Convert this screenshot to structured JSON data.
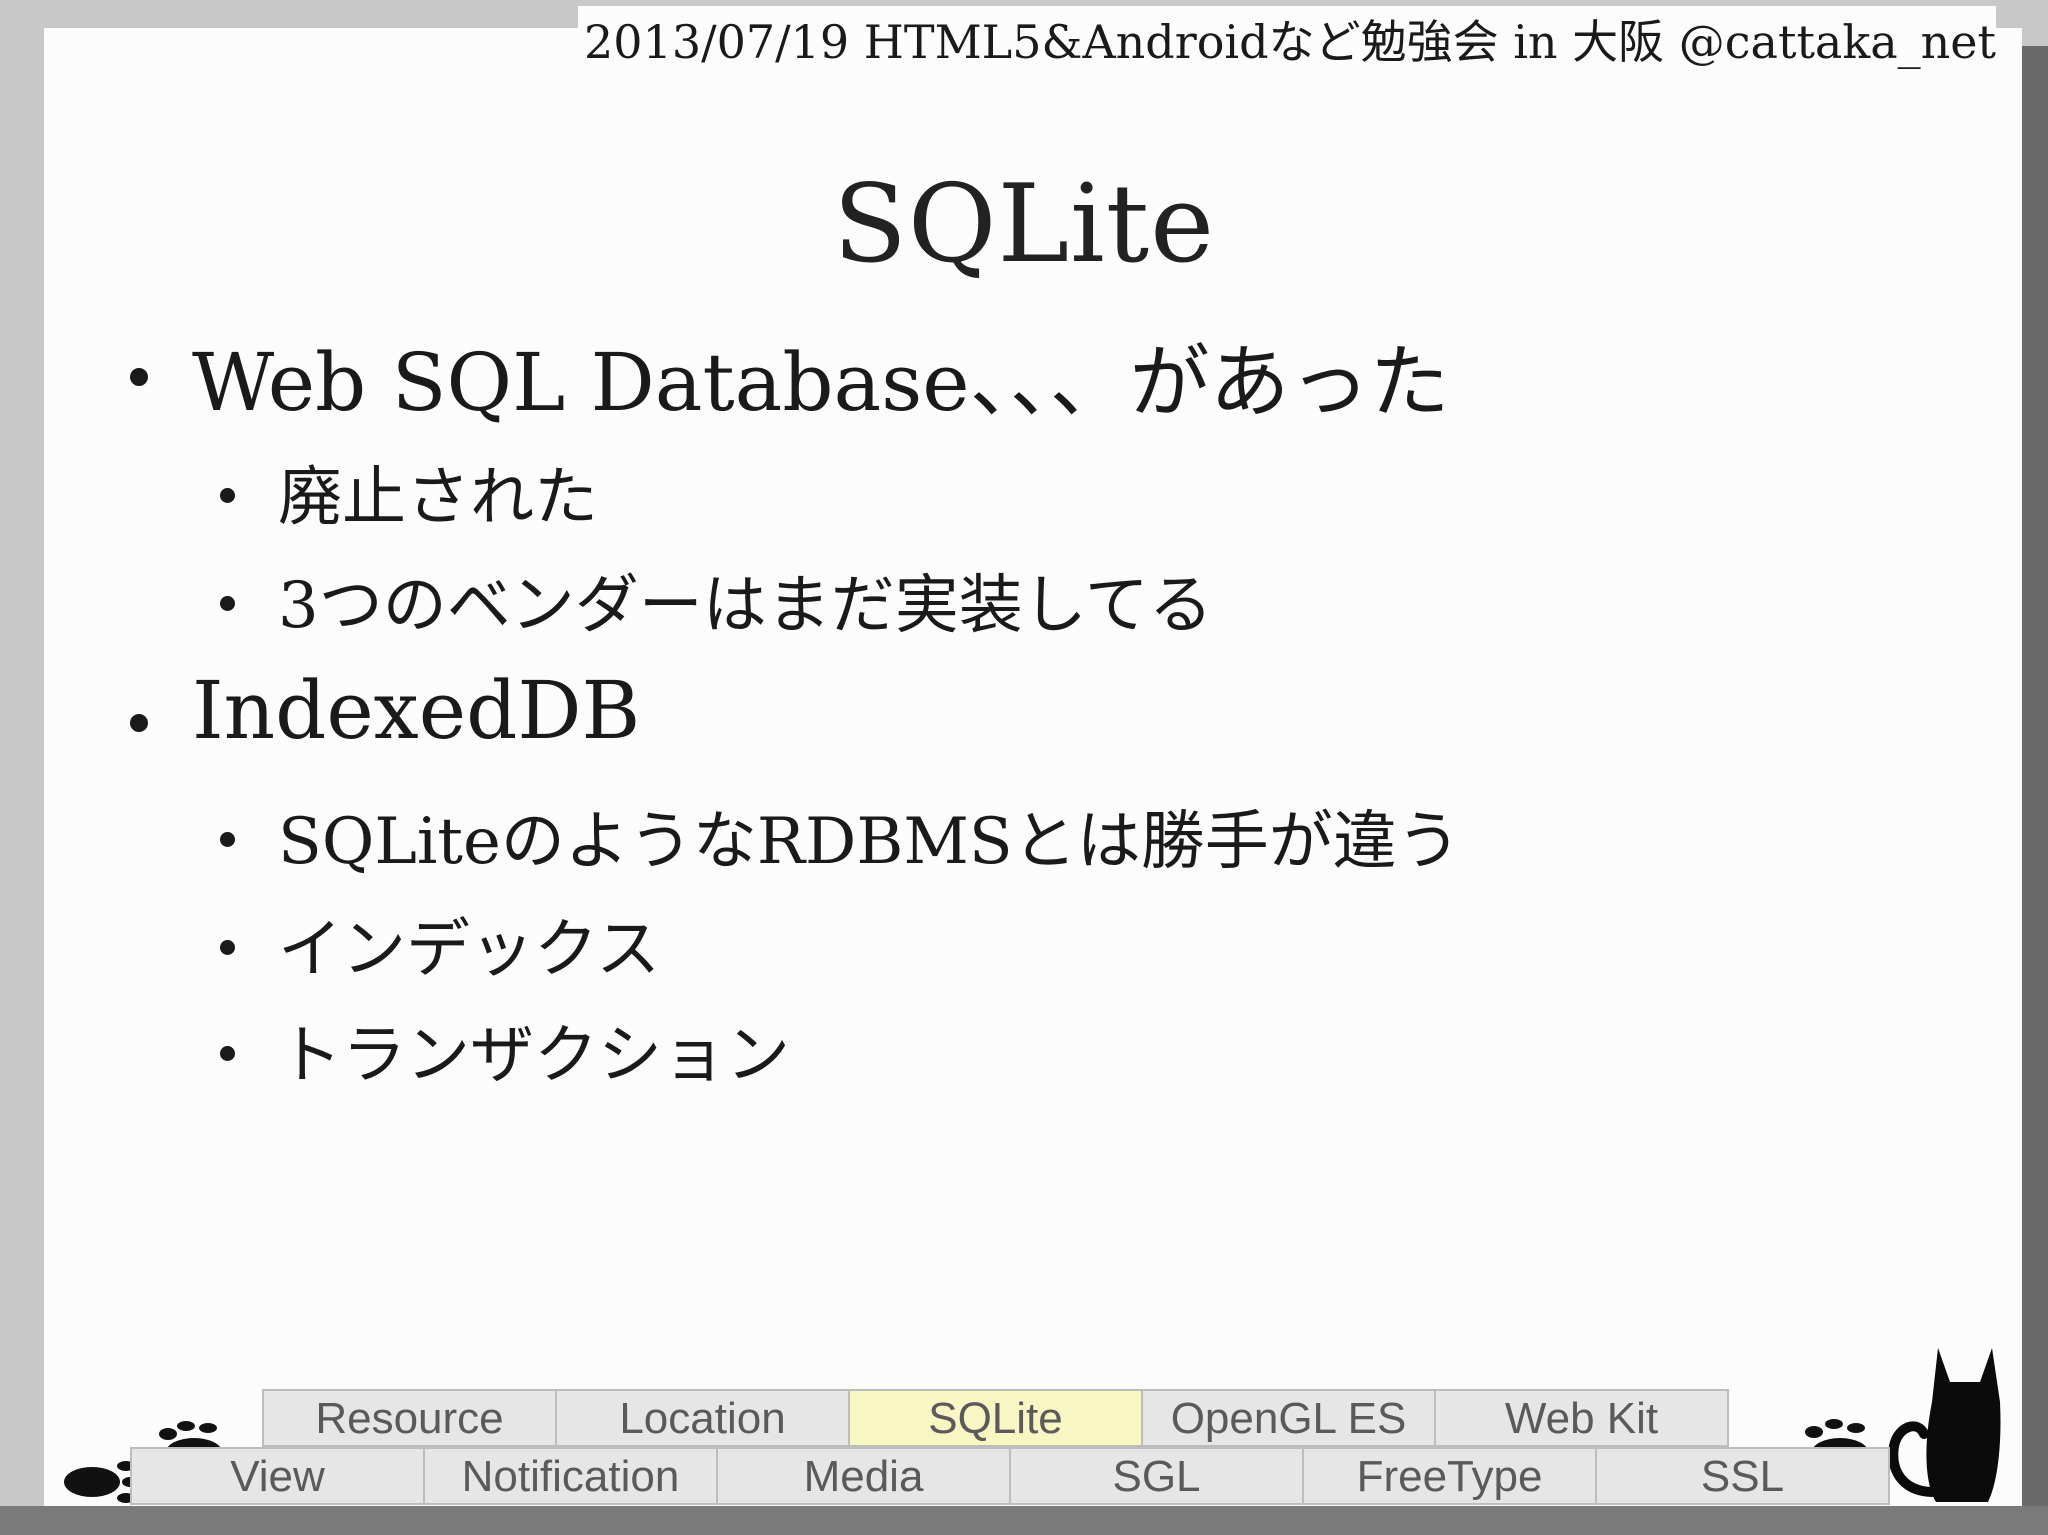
{
  "header": "2013/07/19 HTML5&Androidなど勉強会 in 大阪 @cattaka_net",
  "title": "SQLite",
  "bullets": [
    {
      "text": "Web SQL Database、、、があった",
      "children": [
        "廃止された",
        "3つのベンダーはまだ実装してる"
      ]
    },
    {
      "text": "IndexedDB",
      "children": [
        "SQLiteのようなRDBMSとは勝手が違う",
        "インデックス",
        "トランザクション"
      ]
    }
  ],
  "nav": {
    "row1": [
      "Resource",
      "Location",
      "SQLite",
      "OpenGL ES",
      "Web Kit"
    ],
    "row2": [
      "View",
      "Notification",
      "Media",
      "SGL",
      "FreeType",
      "SSL"
    ],
    "active": "SQLite"
  },
  "colors": {
    "active_tab": "#f8f6c2",
    "tab": "#e6e6e6"
  }
}
